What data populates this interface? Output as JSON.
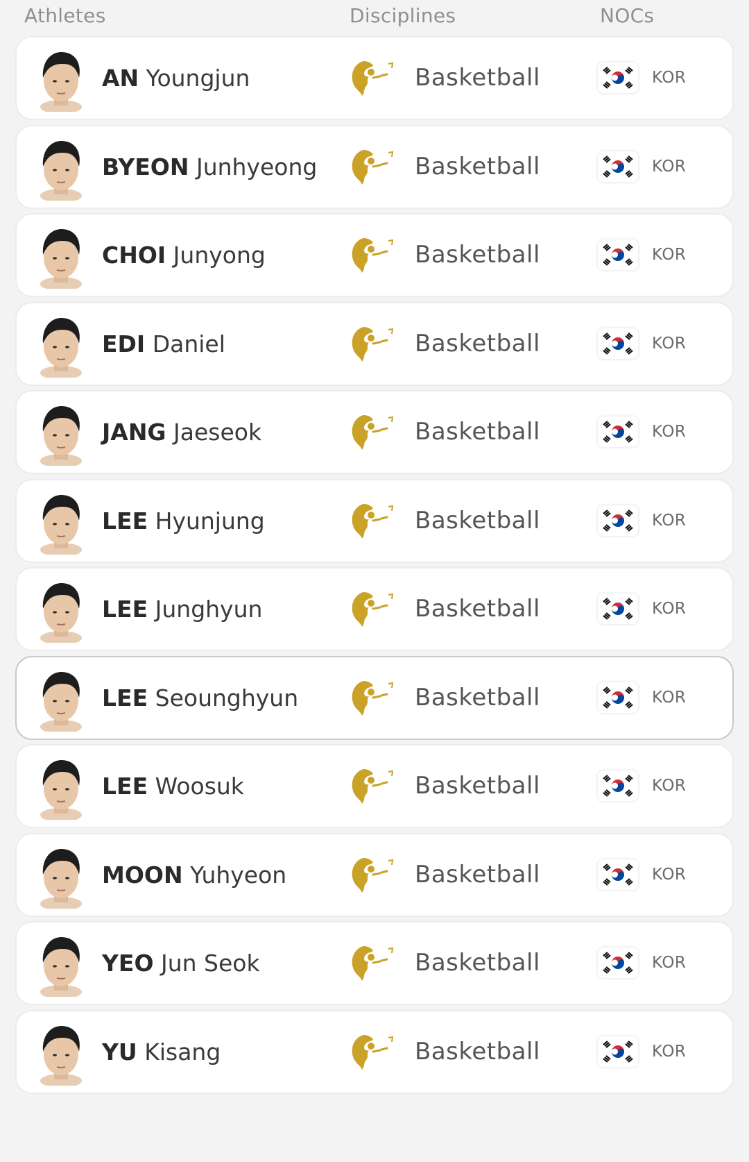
{
  "header": {
    "athletes": "Athletes",
    "disciplines": "Disciplines",
    "nocs": "NOCs"
  },
  "colors": {
    "discipline_icon": "#c9a227",
    "flag_red": "#cd2e3a",
    "flag_blue": "#0047a0"
  },
  "icons": {
    "discipline": "basketball-pictogram-icon",
    "flag": "south-korea-flag-icon",
    "avatar": "athlete-photo"
  },
  "athletes": [
    {
      "last": "AN",
      "first": "Youngjun",
      "discipline": "Basketball",
      "noc": "KOR"
    },
    {
      "last": "BYEON",
      "first": "Junhyeong",
      "discipline": "Basketball",
      "noc": "KOR"
    },
    {
      "last": "CHOI",
      "first": "Junyong",
      "discipline": "Basketball",
      "noc": "KOR"
    },
    {
      "last": "EDI",
      "first": "Daniel",
      "discipline": "Basketball",
      "noc": "KOR"
    },
    {
      "last": "JANG",
      "first": "Jaeseok",
      "discipline": "Basketball",
      "noc": "KOR"
    },
    {
      "last": "LEE",
      "first": "Hyunjung",
      "discipline": "Basketball",
      "noc": "KOR"
    },
    {
      "last": "LEE",
      "first": "Junghyun",
      "discipline": "Basketball",
      "noc": "KOR"
    },
    {
      "last": "LEE",
      "first": "Seounghyun",
      "discipline": "Basketball",
      "noc": "KOR"
    },
    {
      "last": "LEE",
      "first": "Woosuk",
      "discipline": "Basketball",
      "noc": "KOR"
    },
    {
      "last": "MOON",
      "first": "Yuhyeon",
      "discipline": "Basketball",
      "noc": "KOR"
    },
    {
      "last": "YEO",
      "first": "Jun Seok",
      "discipline": "Basketball",
      "noc": "KOR"
    },
    {
      "last": "YU",
      "first": "Kisang",
      "discipline": "Basketball",
      "noc": "KOR"
    }
  ]
}
